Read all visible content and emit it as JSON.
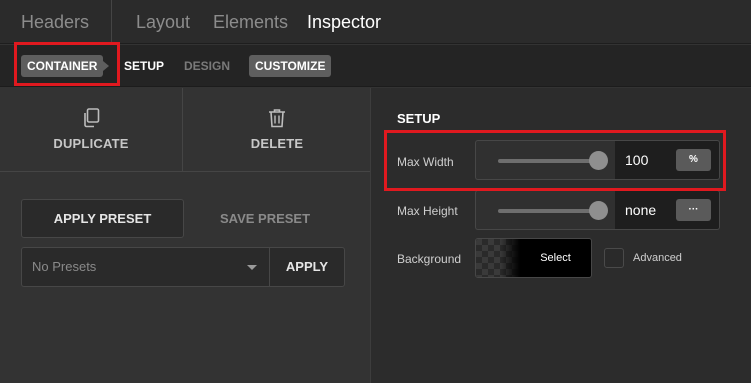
{
  "topbar": {
    "tabs": [
      {
        "label": "Headers",
        "active": false
      },
      {
        "label": "Layout",
        "active": false
      },
      {
        "label": "Elements",
        "active": false
      },
      {
        "label": "Inspector",
        "active": true
      }
    ]
  },
  "breadcrumb": {
    "items": [
      {
        "label": "CONTAINER",
        "state": "current"
      },
      {
        "label": "SETUP",
        "state": "active"
      },
      {
        "label": "DESIGN",
        "state": "dim"
      },
      {
        "label": "CUSTOMIZE",
        "state": "pill"
      }
    ]
  },
  "actions": {
    "duplicate_label": "DUPLICATE",
    "duplicate_icon": "duplicate-icon",
    "delete_label": "DELETE",
    "delete_icon": "trash-icon"
  },
  "presets": {
    "apply_preset_label": "APPLY PRESET",
    "save_preset_label": "SAVE PRESET",
    "select_value": "No Presets",
    "apply_label": "APPLY"
  },
  "setup": {
    "title": "SETUP",
    "max_width": {
      "label": "Max Width",
      "value": "100",
      "unit": "%",
      "slider_fraction": 1.0
    },
    "max_height": {
      "label": "Max Height",
      "value": "none",
      "unit": "···",
      "slider_fraction": 1.0
    },
    "background": {
      "label": "Background",
      "select_label": "Select",
      "advanced_label": "Advanced"
    }
  },
  "colors": {
    "highlight": "#e0191f",
    "panel_bg": "#333333",
    "topbar_bg": "#2b2b2b"
  }
}
